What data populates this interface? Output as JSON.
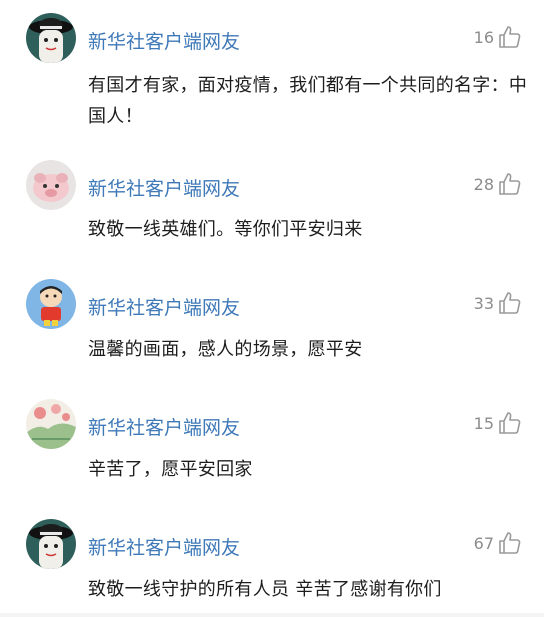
{
  "comments": [
    {
      "username": "新华社客户端网友",
      "likes": "16",
      "text": "有国才有家，面对疫情，我们都有一个共同的名字：中国人！",
      "avatar_icon": "masked-figure-hat-avatar"
    },
    {
      "username": "新华社客户端网友",
      "likes": "28",
      "text": "致敬一线英雄们。等你们平安归来",
      "avatar_icon": "pink-animal-avatar"
    },
    {
      "username": "新华社客户端网友",
      "likes": "33",
      "text": "温馨的画面，感人的场景，愿平安",
      "avatar_icon": "cartoon-boy-avatar"
    },
    {
      "username": "新华社客户端网友",
      "likes": "15",
      "text": "辛苦了，愿平安回家",
      "avatar_icon": "landscape-painting-avatar"
    },
    {
      "username": "新华社客户端网友",
      "likes": "67",
      "text": "致敬一线守护的所有人员 辛苦了感谢有你们",
      "avatar_icon": "masked-figure-hat-avatar"
    }
  ],
  "colors": {
    "username": "#3f79b8",
    "text": "#1d1d1d",
    "likes": "#8c8c8c"
  }
}
